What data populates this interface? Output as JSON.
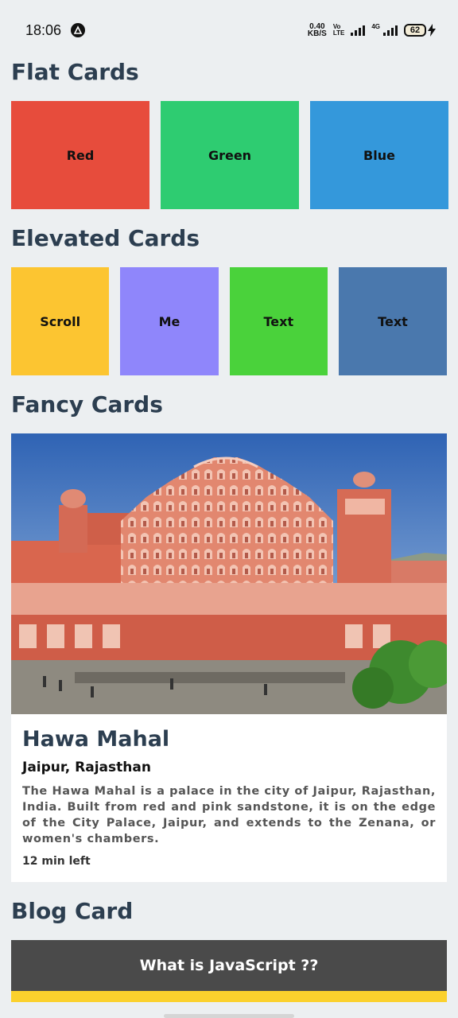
{
  "status_bar": {
    "time": "18:06",
    "net_speed_value": "0.40",
    "net_speed_unit": "KB/S",
    "volte_top": "Vo",
    "volte_bottom": "LTE",
    "net_type": "4G",
    "battery": "62"
  },
  "sections": {
    "flat": "Flat Cards",
    "elevated": "Elevated Cards",
    "fancy": "Fancy Cards",
    "blog": "Blog Card"
  },
  "flat_cards": [
    {
      "label": "Red",
      "color": "#e74c3c"
    },
    {
      "label": "Green",
      "color": "#2ecc71"
    },
    {
      "label": "Blue",
      "color": "#3498db"
    }
  ],
  "elevated_cards": [
    {
      "label": "Scroll",
      "color": "#fcc531"
    },
    {
      "label": "Me",
      "color": "#8f86fb"
    },
    {
      "label": "Text",
      "color": "#4ad23b"
    },
    {
      "label": "Text",
      "color": "#4a78ad"
    }
  ],
  "fancy_card": {
    "title": "Hawa Mahal",
    "subtitle": "Jaipur, Rajasthan",
    "description": "The Hawa Mahal is a palace in the city of Jaipur, Rajasthan, India. Built from red and pink sandstone, it is on the edge of the City Palace, Jaipur, and extends to the Zenana, or women's chambers.",
    "footer": "12 min left"
  },
  "blog_card": {
    "title": "What is JavaScript ??",
    "accent_color": "#fbd12d"
  }
}
